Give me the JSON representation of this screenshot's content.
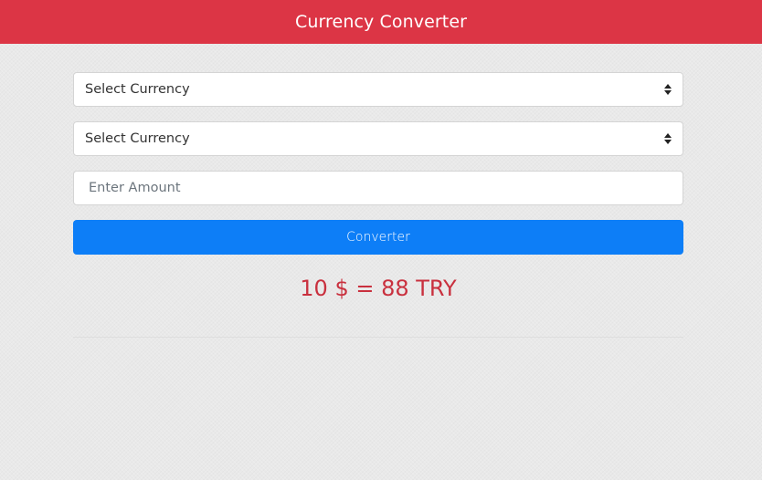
{
  "header": {
    "title": "Currency Converter",
    "background_color": "#dc3545"
  },
  "form": {
    "from_currency": {
      "selected": "Select Currency"
    },
    "to_currency": {
      "selected": "Select Currency"
    },
    "amount": {
      "value": "",
      "placeholder": "Enter Amount"
    },
    "convert_button": {
      "label": "Converter",
      "color": "#0d7ef7"
    }
  },
  "result": {
    "text": "10 $ = 88 TRY",
    "color": "#c9303e"
  },
  "icons": {
    "select_arrow": "up-down-caret-icon"
  }
}
